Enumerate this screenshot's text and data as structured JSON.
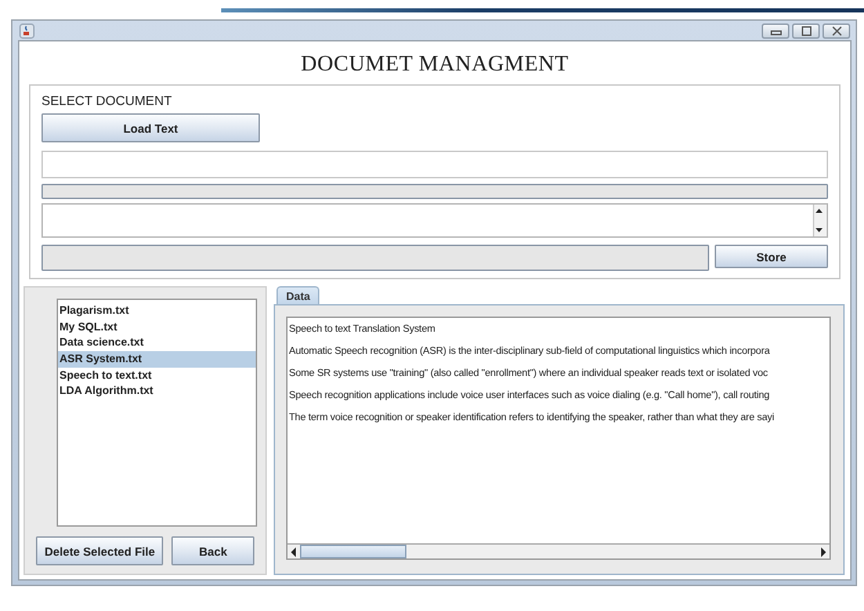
{
  "window": {
    "title": "DOCUMET MANAGMENT"
  },
  "select_panel": {
    "label": "SELECT DOCUMENT",
    "load_button": "Load Text",
    "store_button": "Store"
  },
  "files": [
    {
      "name": "Plagarism.txt",
      "selected": false
    },
    {
      "name": "My SQL.txt",
      "selected": false
    },
    {
      "name": "Data science.txt",
      "selected": false
    },
    {
      "name": "ASR System.txt",
      "selected": true
    },
    {
      "name": "Speech to text.txt",
      "selected": false
    },
    {
      "name": "LDA Algorithm.txt",
      "selected": false
    }
  ],
  "file_buttons": [
    "Delete Selected File",
    "Back"
  ],
  "tabs": [
    {
      "label": "Data",
      "selected": true
    }
  ],
  "data_lines": [
    "Speech to text Translation System",
    "Automatic Speech recognition (ASR) is the inter-disciplinary sub-field of computational linguistics which incorpora",
    "Some SR systems use \"training\" (also called \"enrollment\") where an individual speaker reads text or isolated voc",
    "Speech recognition applications include voice user interfaces such as voice dialing (e.g. \"Call home\"), call routing",
    "The term voice recognition or speaker identification refers to identifying the speaker, rather than what they are sayi"
  ]
}
